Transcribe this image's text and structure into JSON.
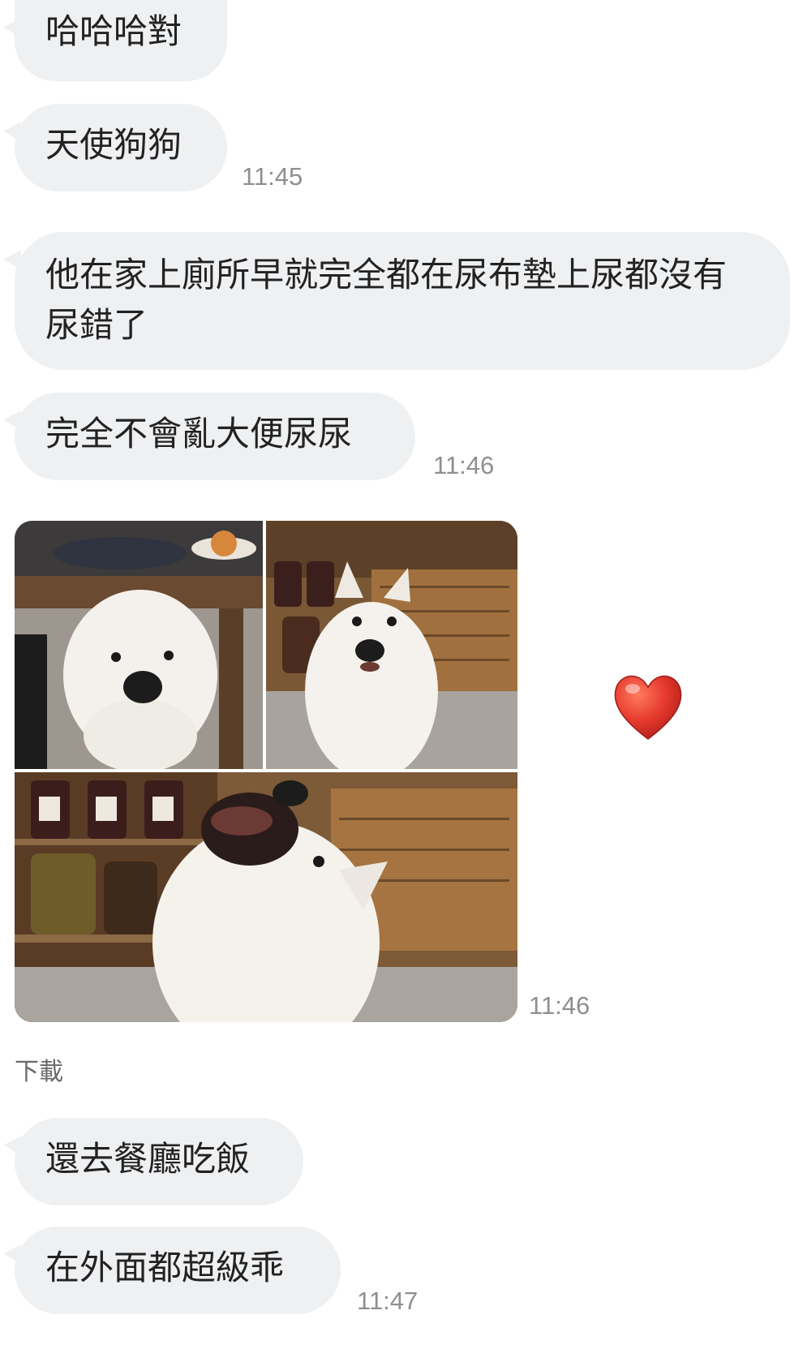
{
  "messages": [
    {
      "text": "哈哈哈對"
    },
    {
      "text": "天使狗狗",
      "time": "11:45"
    },
    {
      "text": "他在家上廁所早就完全都在尿布墊上尿都沒有尿錯了"
    },
    {
      "text": "完全不會亂大便尿尿",
      "time": "11:46"
    },
    {
      "text": "還去餐廳吃飯"
    },
    {
      "text": "在外面都超級乖",
      "time": "11:47"
    }
  ],
  "photo_message": {
    "time": "11:46",
    "download_label": "下載",
    "reaction_icon": "heart-icon"
  },
  "colors": {
    "bubble": "#eff0f2",
    "text": "#222222",
    "timestamp": "#8f8f8f",
    "heart": "#e63a2e"
  }
}
